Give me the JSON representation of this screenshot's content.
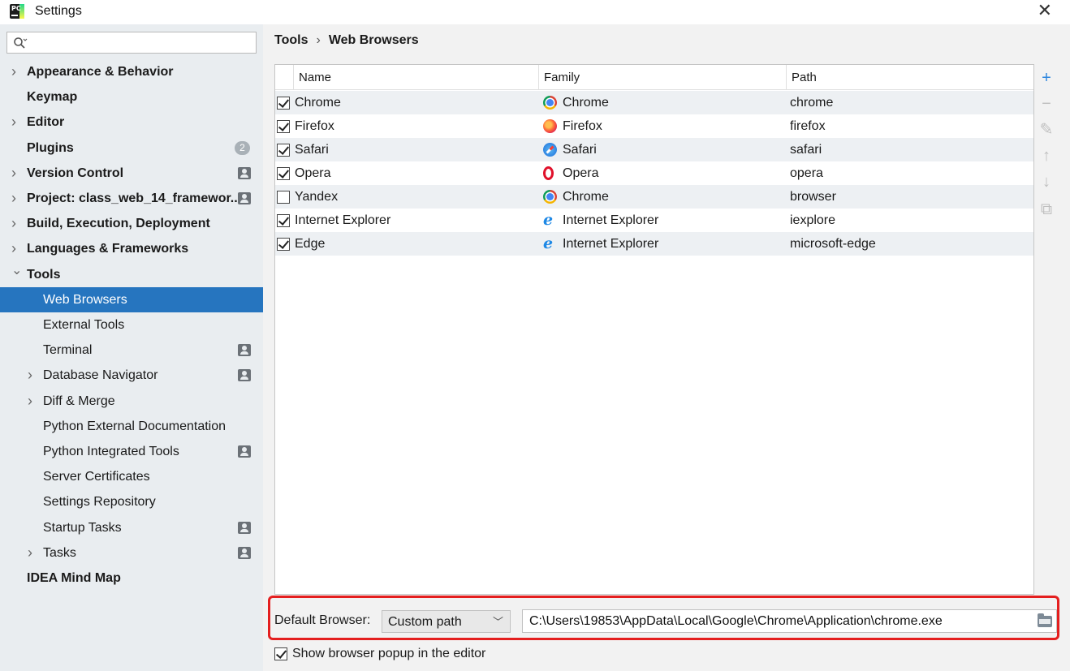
{
  "window": {
    "title": "Settings",
    "close_icon": "close-icon",
    "app_icon": "pycharm-app-icon"
  },
  "sidebar": {
    "search": {
      "value": "",
      "placeholder": ""
    },
    "items": [
      {
        "label": "Appearance & Behavior",
        "level": 0,
        "bold": true,
        "has_arrow": true,
        "expanded": false
      },
      {
        "label": "Keymap",
        "level": 0,
        "bold": true,
        "has_arrow": false
      },
      {
        "label": "Editor",
        "level": 0,
        "bold": true,
        "has_arrow": true,
        "expanded": false
      },
      {
        "label": "Plugins",
        "level": 0,
        "bold": true,
        "has_arrow": false,
        "badge": "2"
      },
      {
        "label": "Version Control",
        "level": 0,
        "bold": true,
        "has_arrow": true,
        "expanded": false,
        "project_icon": true
      },
      {
        "label": "Project: class_web_14_framewor...",
        "level": 0,
        "bold": true,
        "has_arrow": true,
        "expanded": false,
        "project_icon": true
      },
      {
        "label": "Build, Execution, Deployment",
        "level": 0,
        "bold": true,
        "has_arrow": true,
        "expanded": false
      },
      {
        "label": "Languages & Frameworks",
        "level": 0,
        "bold": true,
        "has_arrow": true,
        "expanded": false
      },
      {
        "label": "Tools",
        "level": 0,
        "bold": true,
        "has_arrow": true,
        "expanded": true
      },
      {
        "label": "Web Browsers",
        "level": 1,
        "bold": false,
        "has_arrow": false,
        "selected": true
      },
      {
        "label": "External Tools",
        "level": 1,
        "bold": false,
        "has_arrow": false
      },
      {
        "label": "Terminal",
        "level": 1,
        "bold": false,
        "has_arrow": false,
        "project_icon": true
      },
      {
        "label": "Database Navigator",
        "level": 1,
        "bold": false,
        "has_arrow": true,
        "expanded": false,
        "project_icon": true
      },
      {
        "label": "Diff & Merge",
        "level": 1,
        "bold": false,
        "has_arrow": true,
        "expanded": false
      },
      {
        "label": "Python External Documentation",
        "level": 1,
        "bold": false,
        "has_arrow": false
      },
      {
        "label": "Python Integrated Tools",
        "level": 1,
        "bold": false,
        "has_arrow": false,
        "project_icon": true
      },
      {
        "label": "Server Certificates",
        "level": 1,
        "bold": false,
        "has_arrow": false
      },
      {
        "label": "Settings Repository",
        "level": 1,
        "bold": false,
        "has_arrow": false
      },
      {
        "label": "Startup Tasks",
        "level": 1,
        "bold": false,
        "has_arrow": false,
        "project_icon": true
      },
      {
        "label": "Tasks",
        "level": 1,
        "bold": false,
        "has_arrow": true,
        "expanded": false,
        "project_icon": true
      },
      {
        "label": "IDEA Mind Map",
        "level": 0,
        "bold": true,
        "has_arrow": false
      }
    ]
  },
  "breadcrumb": {
    "parent": "Tools",
    "separator": "›",
    "current": "Web Browsers"
  },
  "table": {
    "columns": [
      "Name",
      "Family",
      "Path"
    ],
    "rows": [
      {
        "checked": true,
        "name": "Chrome",
        "family": "Chrome",
        "family_icon": "chrome",
        "path": "chrome"
      },
      {
        "checked": true,
        "name": "Firefox",
        "family": "Firefox",
        "family_icon": "firefox",
        "path": "firefox"
      },
      {
        "checked": true,
        "name": "Safari",
        "family": "Safari",
        "family_icon": "safari",
        "path": "safari"
      },
      {
        "checked": true,
        "name": "Opera",
        "family": "Opera",
        "family_icon": "opera",
        "path": "opera"
      },
      {
        "checked": false,
        "name": "Yandex",
        "family": "Chrome",
        "family_icon": "chrome",
        "path": "browser"
      },
      {
        "checked": true,
        "name": "Internet Explorer",
        "family": "Internet Explorer",
        "family_icon": "ie",
        "path": "iexplore"
      },
      {
        "checked": true,
        "name": "Edge",
        "family": "Internet Explorer",
        "family_icon": "ie",
        "path": "microsoft-edge"
      }
    ]
  },
  "side_tools": [
    {
      "name": "add-icon",
      "glyph": "+",
      "enabled": true
    },
    {
      "name": "remove-icon",
      "glyph": "−",
      "enabled": false
    },
    {
      "name": "edit-icon",
      "glyph": "✎",
      "enabled": false
    },
    {
      "name": "move-up-icon",
      "glyph": "↑",
      "enabled": false
    },
    {
      "name": "move-down-icon",
      "glyph": "↓",
      "enabled": false
    },
    {
      "name": "copy-icon",
      "glyph": "⧉",
      "enabled": false
    }
  ],
  "default_browser": {
    "label": "Default Browser:",
    "selected": "Custom path",
    "path_value": "C:\\Users\\19853\\AppData\\Local\\Google\\Chrome\\Application\\chrome.exe"
  },
  "popup_option": {
    "label": "Show browser popup in the editor",
    "checked": true
  },
  "colors": {
    "selection": "#2675bf",
    "highlight_box": "#e41f1f",
    "accent": "#2e86de"
  }
}
